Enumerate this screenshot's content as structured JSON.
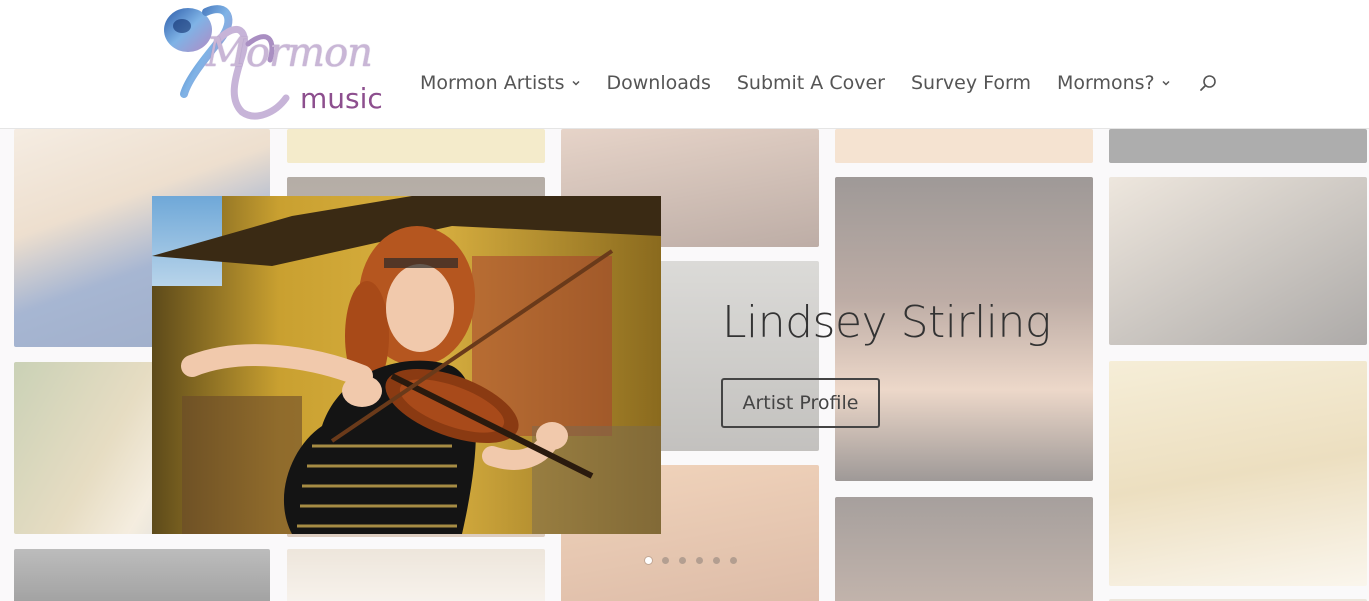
{
  "logo": {
    "word1": "Mormon",
    "word2": "music",
    "icon": "music-note-swirl-icon"
  },
  "nav": {
    "items": [
      {
        "label": "Mormon Artists",
        "dropdown": true
      },
      {
        "label": "Downloads",
        "dropdown": false
      },
      {
        "label": "Submit A Cover",
        "dropdown": false
      },
      {
        "label": "Survey Form",
        "dropdown": false
      },
      {
        "label": "Mormons?",
        "dropdown": true
      }
    ],
    "search_icon": "search-icon"
  },
  "hero": {
    "title": "Lindsey Stirling",
    "button_label": "Artist Profile",
    "slide_count": 6,
    "active_slide": 1
  },
  "colors": {
    "nav_text": "#555555",
    "title_text": "#333333",
    "button_border": "#444444",
    "logo_purple": "#8d4f8e"
  }
}
